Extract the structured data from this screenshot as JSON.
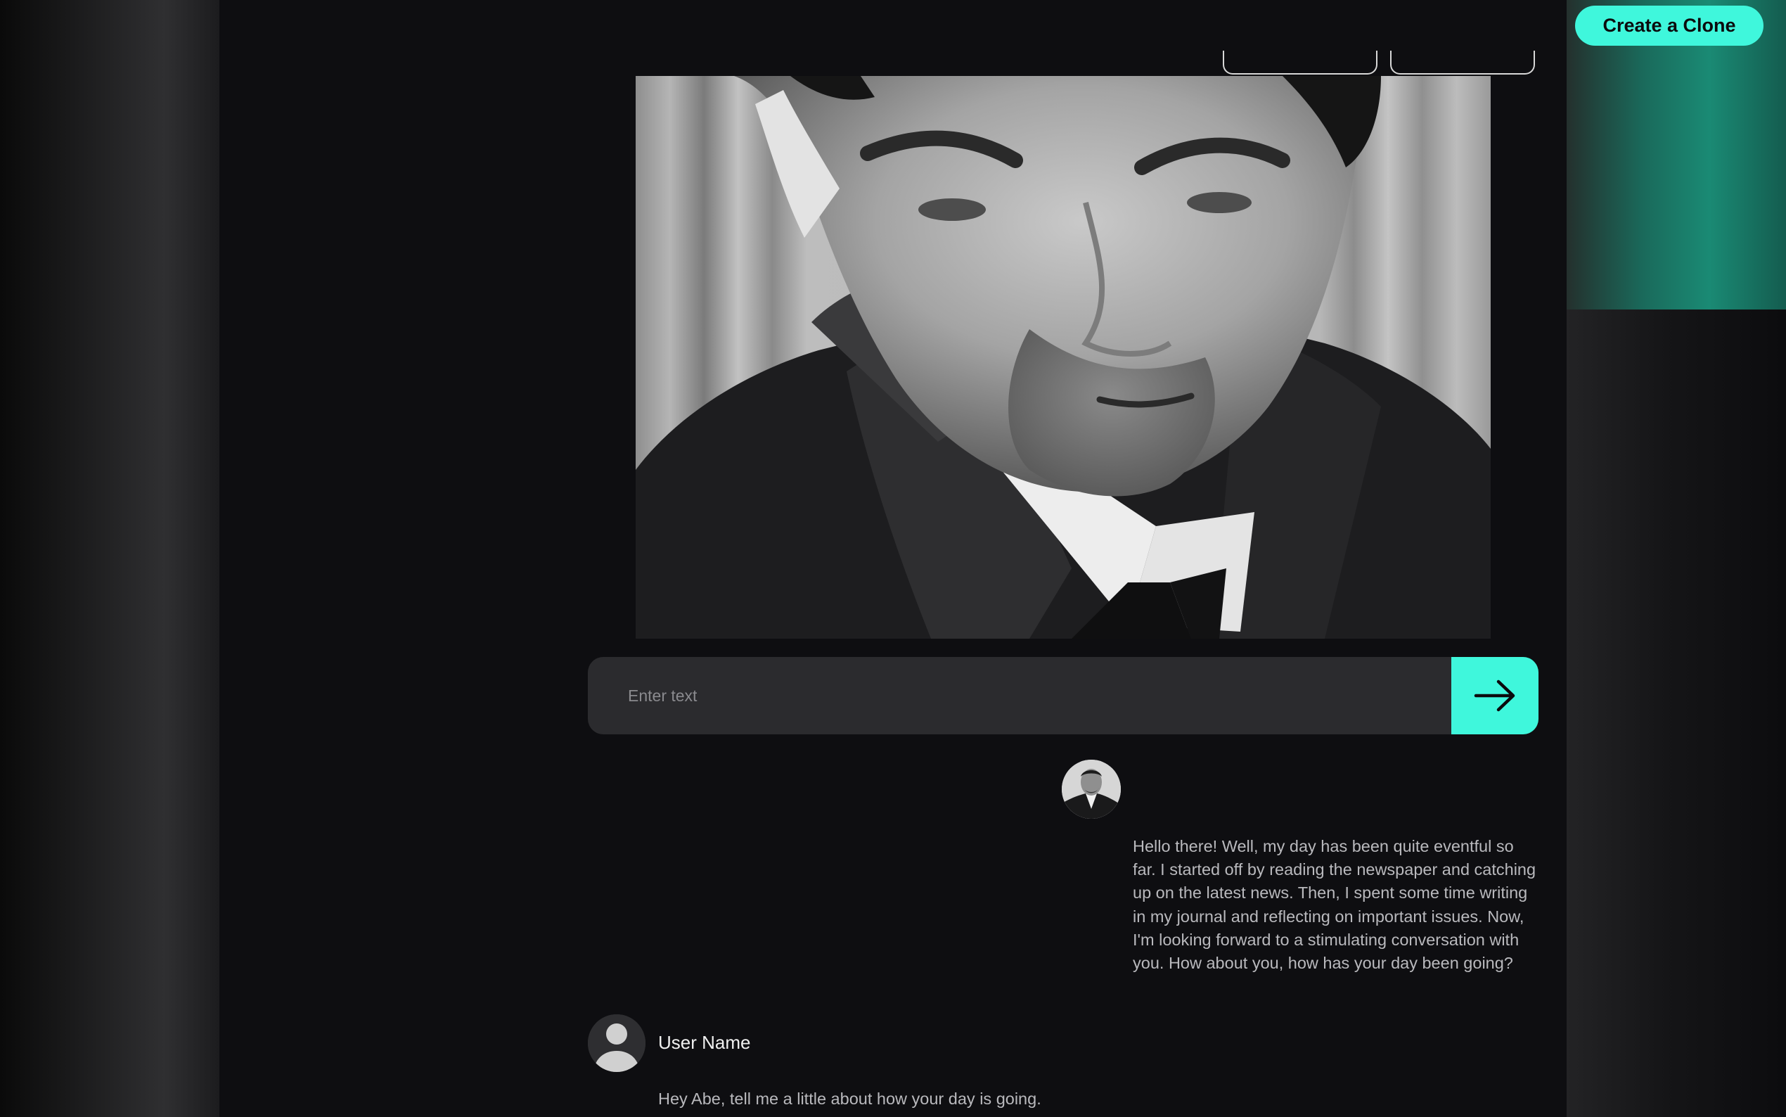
{
  "header": {
    "create_clone_label": "Create a Clone"
  },
  "composer": {
    "placeholder": "Enter text"
  },
  "conversation": {
    "bot_message": "Hello there! Well, my day has been quite eventful so far. I started off by reading the newspaper and catching up on the latest news. Then, I spent some time writing in my journal and reflecting on important issues. Now, I'm looking forward to a stimulating conversation with you. How about you, how has your day been going?",
    "user_name": "User Name",
    "user_message": "Hey Abe, tell me a little about how your day is going."
  },
  "icons": {
    "send": "arrow-right-icon",
    "user_avatar": "person-silhouette-icon"
  },
  "colors": {
    "accent": "#3ff7dc",
    "background": "#0e0e11",
    "input_bg": "#2b2b2e"
  }
}
